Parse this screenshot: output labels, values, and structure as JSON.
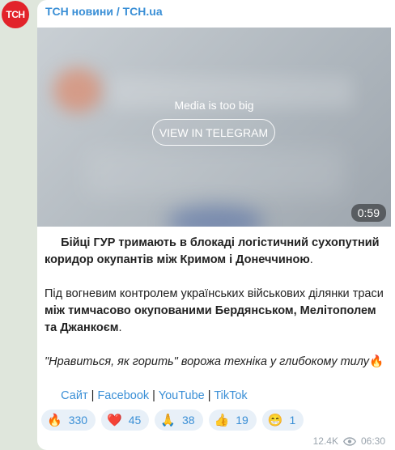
{
  "channel": {
    "avatar_text": "ТСН",
    "name": "ТСН новини / TCH.ua"
  },
  "media": {
    "note": "Media is too big",
    "button_label": "VIEW IN TELEGRAM",
    "duration": "0:59"
  },
  "post": {
    "p1_bold": "Бійці ГУР тримають в блокаді логістичний сухопутний коридор окупантів між Кримом і Донеччиною",
    "p1_tail": ".",
    "p2_plain": "Під вогневим контролем українських військових ділянки траси ",
    "p2_bold": "між тимчасово окупованими Бердянськом, Мелітополем та Джанкоєм",
    "p2_tail": ".",
    "p3_italic": "\"Нравиться, як горить\" ворожа техніка у глибокому тилу",
    "p3_emoji": "🔥",
    "links": [
      {
        "label": "Сайт"
      },
      {
        "label": "Facebook"
      },
      {
        "label": "YouTube"
      },
      {
        "label": "TikTok"
      }
    ],
    "separator": "|"
  },
  "reactions": [
    {
      "emoji": "🔥",
      "icon": "fire-icon",
      "count": "330"
    },
    {
      "emoji": "❤️",
      "icon": "heart-icon",
      "count": "45"
    },
    {
      "emoji": "🙏",
      "icon": "pray-icon",
      "count": "38"
    },
    {
      "emoji": "👍",
      "icon": "thumbs-up-icon",
      "count": "19"
    },
    {
      "emoji": "😁",
      "icon": "grin-icon",
      "count": "1"
    }
  ],
  "meta": {
    "views": "12.4K",
    "time": "06:30"
  },
  "colors": {
    "accent": "#3a8fd6",
    "avatar_bg": "#e2232a",
    "reaction_bg": "#e8f0f8"
  }
}
